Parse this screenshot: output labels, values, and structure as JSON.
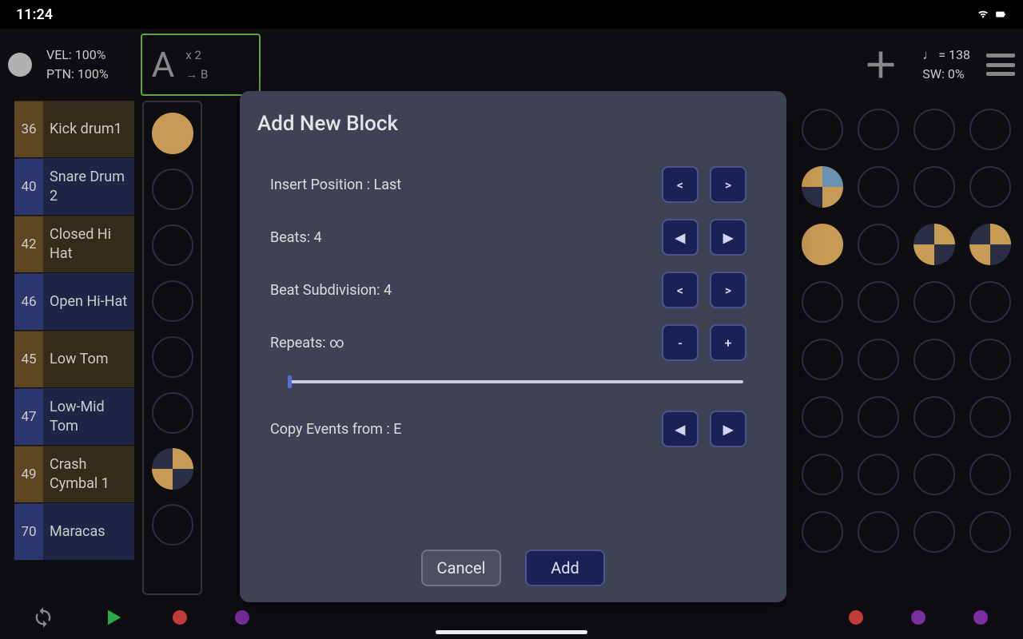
{
  "status": {
    "time": "11:24"
  },
  "header": {
    "vel": "VEL: 100%",
    "ptn": "PTN: 100%",
    "block_letter": "A",
    "block_sub1": "x 2",
    "block_sub2": "→ B",
    "tempo": "♩ = 138",
    "swing": "SW: 0%"
  },
  "tracks": [
    {
      "num": "36",
      "name": "Kick drum1",
      "tone": "brown"
    },
    {
      "num": "40",
      "name": "Snare Drum 2",
      "tone": "blue"
    },
    {
      "num": "42",
      "name": "Closed Hi Hat",
      "tone": "brown"
    },
    {
      "num": "46",
      "name": "Open Hi-Hat",
      "tone": "blue"
    },
    {
      "num": "45",
      "name": "Low Tom",
      "tone": "brown"
    },
    {
      "num": "47",
      "name": "Low-Mid Tom",
      "tone": "blue"
    },
    {
      "num": "49",
      "name": "Crash Cymbal 1",
      "tone": "brown"
    },
    {
      "num": "70",
      "name": "Maracas",
      "tone": "blue"
    }
  ],
  "modal": {
    "title": "Add New Block",
    "rows": {
      "insert_position": "Insert Position : Last",
      "beats": "Beats: 4",
      "subdivision": "Beat Subdivision: 4",
      "repeats": "Repeats: ∞",
      "copy_from": "Copy Events from : E"
    },
    "glyphs": {
      "left": "<",
      "right": ">",
      "tri_left": "◀",
      "tri_right": "▶",
      "minus": "-",
      "plus": "+"
    },
    "actions": {
      "cancel": "Cancel",
      "add": "Add"
    }
  }
}
